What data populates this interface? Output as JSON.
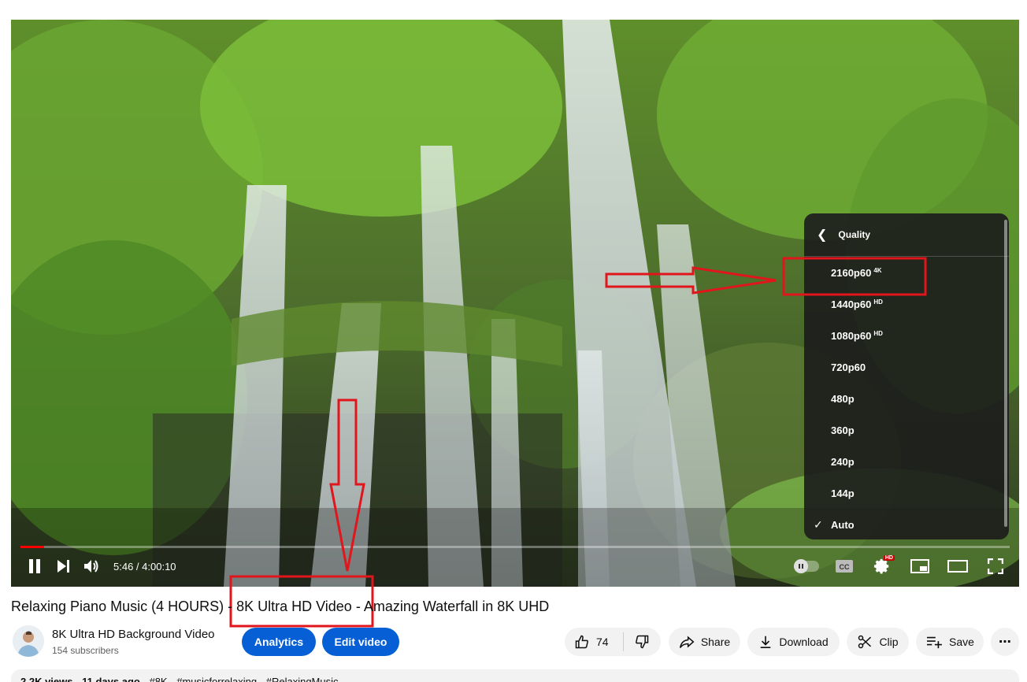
{
  "player": {
    "time_current": "5:46",
    "time_separator": " / ",
    "time_total": "4:00:10",
    "progress": 0.024,
    "settings_badge": "HD",
    "icons": [
      "pause-icon",
      "next-icon",
      "volume-icon",
      "autoplay-toggle",
      "cc-icon",
      "gear-icon",
      "miniplayer-icon",
      "theater-icon",
      "fullscreen-icon"
    ]
  },
  "quality_menu": {
    "title": "Quality",
    "options": [
      {
        "label": "2160p60",
        "badge": "4K"
      },
      {
        "label": "1440p60",
        "badge": "HD"
      },
      {
        "label": "1080p60",
        "badge": "HD"
      },
      {
        "label": "720p60",
        "badge": ""
      },
      {
        "label": "480p",
        "badge": ""
      },
      {
        "label": "360p",
        "badge": ""
      },
      {
        "label": "240p",
        "badge": ""
      },
      {
        "label": "144p",
        "badge": ""
      },
      {
        "label": "Auto",
        "badge": "",
        "selected": true
      }
    ]
  },
  "video": {
    "title": "Relaxing Piano Music (4 HOURS) - 8K Ultra HD Video - Amazing Waterfall in 8K UHD"
  },
  "channel": {
    "name": "8K Ultra HD Background Video",
    "subscribers": "154 subscribers"
  },
  "actions": {
    "analytics": "Analytics",
    "edit_video": "Edit video",
    "likes": "74",
    "share": "Share",
    "download": "Download",
    "clip": "Clip",
    "save": "Save"
  },
  "description": {
    "views": "2.2K views",
    "age": "11 days ago",
    "tags": [
      "#8K",
      "#musicforrelaxing",
      "#RelaxingMusic"
    ]
  },
  "colors": {
    "accent_blue": "#065fd4",
    "progress_red": "#ff0000",
    "annotation_red": "#e0161c"
  }
}
